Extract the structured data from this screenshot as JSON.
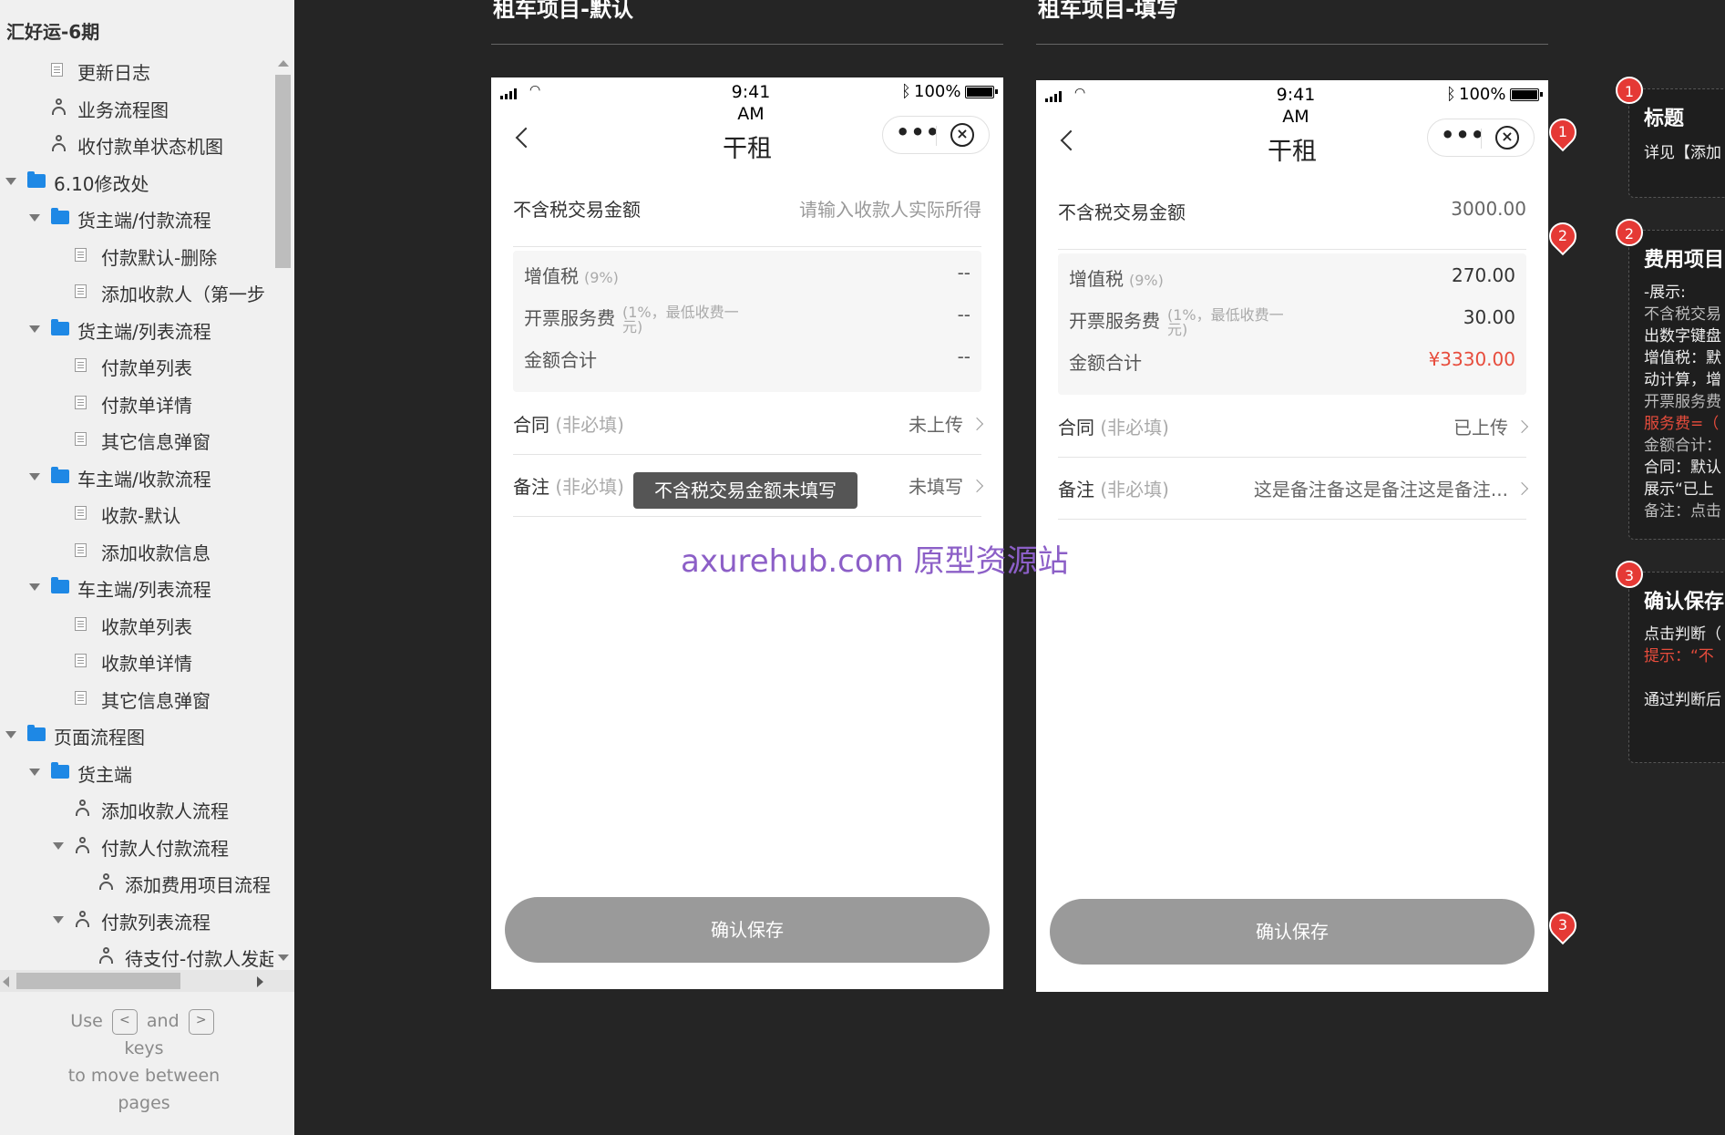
{
  "sidebar": {
    "project_title": "汇好运-6期",
    "items": [
      {
        "label": "更新日志",
        "type": "page",
        "level": 1,
        "expanded": false
      },
      {
        "label": "业务流程图",
        "type": "flow",
        "level": 1,
        "expanded": false
      },
      {
        "label": "收付款单状态机图",
        "type": "flow",
        "level": 1,
        "expanded": false
      },
      {
        "label": "6.10修改处",
        "type": "folder",
        "level": 0,
        "expanded": true
      },
      {
        "label": "货主端/付款流程",
        "type": "folder",
        "level": 1,
        "expanded": true
      },
      {
        "label": "付款默认-删除",
        "type": "page",
        "level": 2,
        "expanded": false
      },
      {
        "label": "添加收款人（第一步",
        "type": "page",
        "level": 2,
        "expanded": false
      },
      {
        "label": "货主端/列表流程",
        "type": "folder",
        "level": 1,
        "expanded": true
      },
      {
        "label": "付款单列表",
        "type": "page",
        "level": 2,
        "expanded": false
      },
      {
        "label": "付款单详情",
        "type": "page",
        "level": 2,
        "expanded": false
      },
      {
        "label": "其它信息弹窗",
        "type": "page",
        "level": 2,
        "expanded": false
      },
      {
        "label": "车主端/收款流程",
        "type": "folder",
        "level": 1,
        "expanded": true
      },
      {
        "label": "收款-默认",
        "type": "page",
        "level": 2,
        "expanded": false
      },
      {
        "label": "添加收款信息",
        "type": "page",
        "level": 2,
        "expanded": false
      },
      {
        "label": "车主端/列表流程",
        "type": "folder",
        "level": 1,
        "expanded": true
      },
      {
        "label": "收款单列表",
        "type": "page",
        "level": 2,
        "expanded": false
      },
      {
        "label": "收款单详情",
        "type": "page",
        "level": 2,
        "expanded": false
      },
      {
        "label": "其它信息弹窗",
        "type": "page",
        "level": 2,
        "expanded": false
      },
      {
        "label": "页面流程图",
        "type": "folder",
        "level": 0,
        "expanded": true
      },
      {
        "label": "货主端",
        "type": "folder",
        "level": 1,
        "expanded": true
      },
      {
        "label": "添加收款人流程",
        "type": "flow",
        "level": 2,
        "expanded": false
      },
      {
        "label": "付款人付款流程",
        "type": "flow",
        "level": 2,
        "expanded": true
      },
      {
        "label": "添加费用项目流程",
        "type": "flow",
        "level": 3,
        "expanded": false
      },
      {
        "label": "付款列表流程",
        "type": "flow",
        "level": 2,
        "expanded": true
      },
      {
        "label": "待支付-付款人发起",
        "type": "flow",
        "level": 3,
        "expanded": false
      }
    ],
    "key_hint": {
      "use": "Use",
      "prev_key": "<",
      "and": "and",
      "next_key": ">",
      "keys": "keys",
      "rest_1": "to move between",
      "rest_2": "pages"
    }
  },
  "pages": [
    {
      "heading": "租车项目-默认",
      "status": {
        "time": "9:41\nAM",
        "battery": "100%"
      },
      "nav_title": "干租",
      "amount": {
        "label": "不含税交易金额",
        "value": "请输入收款人实际所得",
        "is_placeholder": true
      },
      "fees": {
        "vat_label": "增值税",
        "vat_note": "(9%)",
        "vat_value": "--",
        "service_label": "开票服务费",
        "service_note": "(1%，最低收费一元)",
        "service_value": "--",
        "total_label": "金额合计",
        "total_value": "--"
      },
      "contract": {
        "label": "合同",
        "optional": "(非必填)",
        "value": "未上传"
      },
      "remark": {
        "label": "备注",
        "optional": "(非必填)",
        "value": "未填写"
      },
      "toast": "不含税交易金额未填写",
      "save_label": "确认保存"
    },
    {
      "heading": "租车项目-填写",
      "status": {
        "time": "9:41\nAM",
        "battery": "100%"
      },
      "nav_title": "干租",
      "amount": {
        "label": "不含税交易金额",
        "value": "3000.00",
        "is_placeholder": false
      },
      "fees": {
        "vat_label": "增值税",
        "vat_note": "(9%)",
        "vat_value": "270.00",
        "service_label": "开票服务费",
        "service_note": "(1%，最低收费一元)",
        "service_value": "30.00",
        "total_label": "金额合计",
        "total_value": "¥3330.00"
      },
      "contract": {
        "label": "合同",
        "optional": "(非必填)",
        "value": "已上传"
      },
      "remark": {
        "label": "备注",
        "optional": "(非必填)",
        "value": "这是备注备这是备注这是备注..."
      },
      "save_label": "确认保存"
    }
  ],
  "watermark": "axurehub.com 原型资源站",
  "markers": [
    "1",
    "2",
    "3"
  ],
  "annotations": [
    {
      "num": "1",
      "title": "标题",
      "lines": [
        "详见【添加"
      ]
    },
    {
      "num": "2",
      "title": "费用项目",
      "lines": [
        "-展示:",
        "不含税交易",
        "出数字键盘",
        "增值税：默",
        "动计算，增",
        "开票服务费",
        "服务费=（",
        "金额合计：",
        "合同：默认",
        "展示“已上",
        "备注：点击"
      ]
    },
    {
      "num": "3",
      "title": "确认保存",
      "lines": [
        "点击判断（",
        "提示：“不",
        "",
        "通过判断后"
      ]
    }
  ],
  "colors": {
    "accent_red": "#e74c3c",
    "marker_red": "#e53935",
    "folder_blue": "#1e88e5",
    "button_gray": "#9a9a9a"
  }
}
